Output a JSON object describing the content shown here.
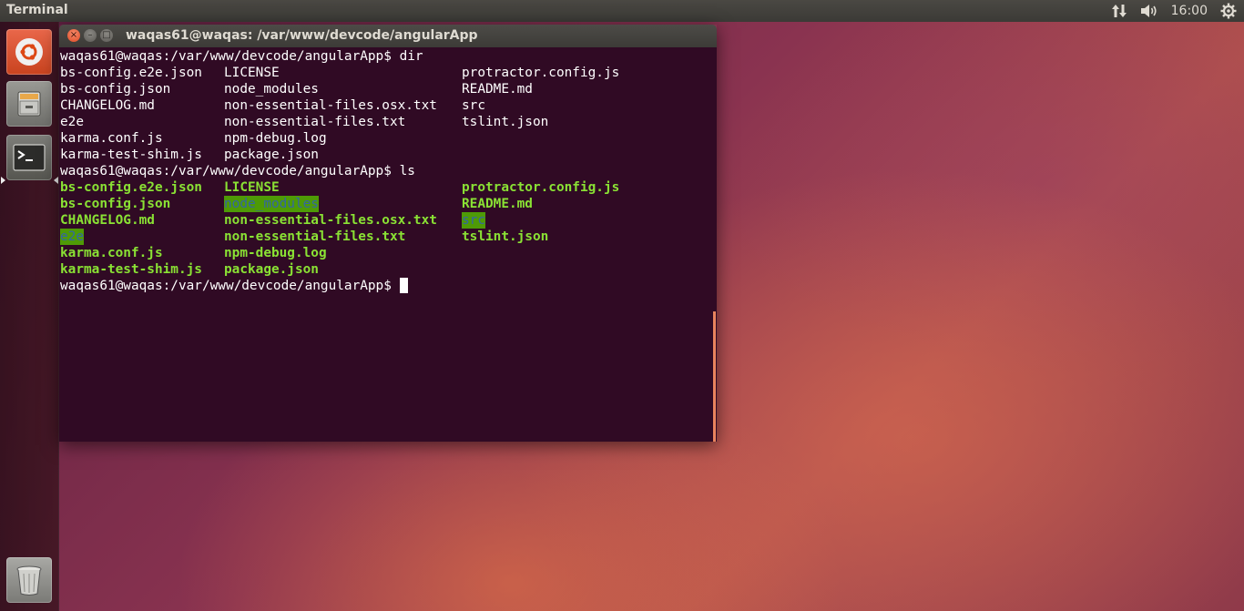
{
  "top_panel": {
    "app_title": "Terminal",
    "clock": "16:00",
    "indicators": [
      "network-updown-icon",
      "volume-icon",
      "settings-gear-icon"
    ]
  },
  "launcher": {
    "items": [
      {
        "name": "dash",
        "icon": "ubuntu-logo-icon"
      },
      {
        "name": "files",
        "icon": "file-cabinet-icon"
      },
      {
        "name": "terminal",
        "icon": "terminal-icon",
        "running": true
      },
      {
        "name": "trash",
        "icon": "trash-icon"
      }
    ]
  },
  "window": {
    "title": "waqas61@waqas: /var/www/devcode/angularApp",
    "close_glyph": "×",
    "min_glyph": "–",
    "max_glyph": "□"
  },
  "terminal": {
    "prompt": "waqas61@waqas:/var/www/devcode/angularApp$",
    "cmd_dir": "dir",
    "cmd_ls": "ls",
    "dir_rows": [
      [
        "bs-config.e2e.json",
        "LICENSE",
        "protractor.config.js"
      ],
      [
        "bs-config.json",
        "node_modules",
        "README.md"
      ],
      [
        "CHANGELOG.md",
        "non-essential-files.osx.txt",
        "src"
      ],
      [
        "e2e",
        "non-essential-files.txt",
        "tslint.json"
      ],
      [
        "karma.conf.js",
        "npm-debug.log",
        ""
      ],
      [
        "karma-test-shim.js",
        "package.json",
        ""
      ]
    ],
    "ls_rows": [
      [
        "bs-config.e2e.json",
        "LICENSE",
        "protractor.config.js"
      ],
      [
        "bs-config.json",
        "node_modules",
        "README.md"
      ],
      [
        "CHANGELOG.md",
        "non-essential-files.osx.txt",
        "src"
      ],
      [
        "e2e",
        "non-essential-files.txt",
        "tslint.json"
      ],
      [
        "karma.conf.js",
        "npm-debug.log",
        ""
      ],
      [
        "karma-test-shim.js",
        "package.json",
        ""
      ]
    ],
    "colors": {
      "background": "#300a24",
      "text": "#ffffff",
      "file_green": "#8ae234",
      "dir_highlight_bg": "#4e9a06",
      "dir_highlight_fg": "#3465a4"
    }
  }
}
